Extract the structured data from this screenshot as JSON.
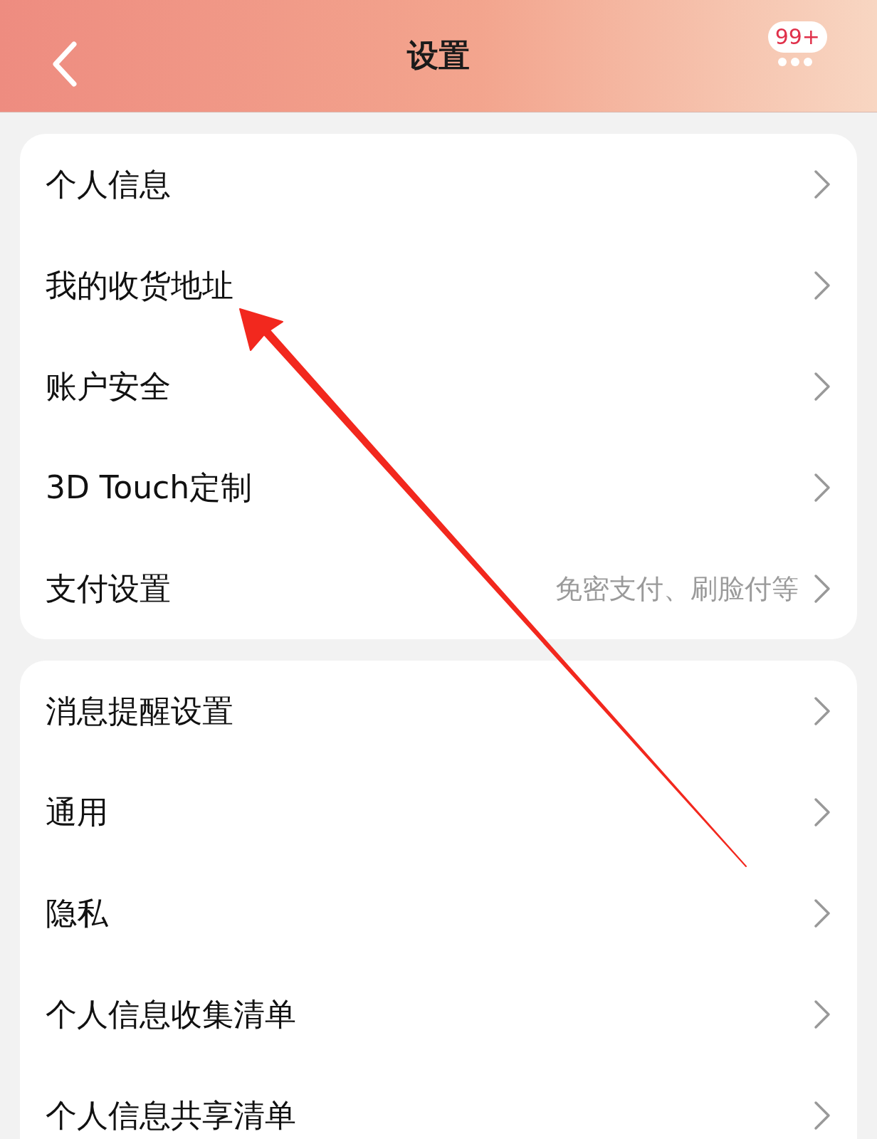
{
  "header": {
    "title": "设置",
    "badge": "99+"
  },
  "groups": [
    {
      "items": [
        {
          "label": "个人信息"
        },
        {
          "label": "我的收货地址"
        },
        {
          "label": "账户安全"
        },
        {
          "label": "3D Touch定制"
        },
        {
          "label": "支付设置",
          "hint": "免密支付、刷脸付等"
        }
      ]
    },
    {
      "items": [
        {
          "label": "消息提醒设置"
        },
        {
          "label": "通用"
        },
        {
          "label": "隐私"
        },
        {
          "label": "个人信息收集清单"
        },
        {
          "label": "个人信息共享清单"
        }
      ]
    }
  ]
}
